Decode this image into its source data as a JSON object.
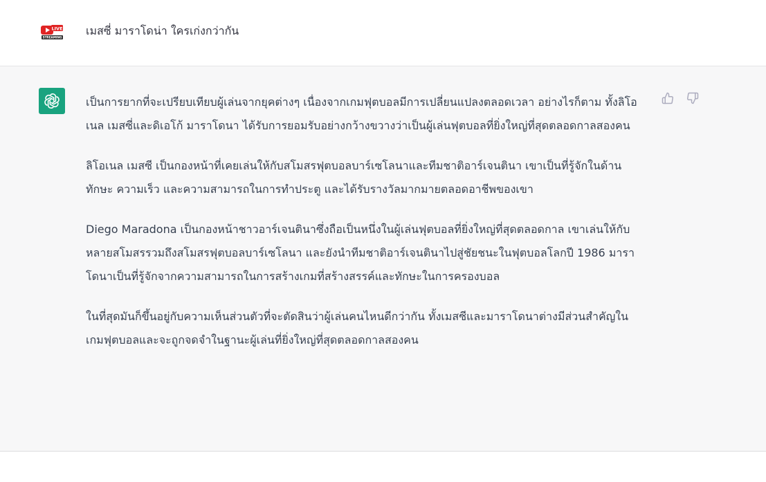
{
  "conversation": {
    "user_message": {
      "avatar_icon": "live-streaming-avatar-icon",
      "avatar_badge": "LIVE",
      "avatar_caption": "STREAMING",
      "text": "เมสซี่ มาราโดน่า ใครเก่งกว่ากัน"
    },
    "assistant_message": {
      "avatar_icon": "openai-logo-icon",
      "avatar_color": "#19a37f",
      "paragraphs": [
        "เป็นการยากที่จะเปรียบเทียบผู้เล่นจากยุคต่างๆ เนื่องจากเกมฟุตบอลมีการเปลี่ยนแปลงตลอดเวลา อย่างไรก็ตาม ทั้งลิโอเนล เมสซี่และดิเอโก้ มาราโดนา ได้รับการยอมรับอย่างกว้างขวางว่าเป็นผู้เล่นฟุตบอลที่ยิ่งใหญ่ที่สุดตลอดกาลสองคน",
        "ลิโอเนล เมสซี เป็นกองหน้าที่เคยเล่นให้กับสโมสรฟุตบอลบาร์เซโลนาและทีมชาติอาร์เจนตินา เขาเป็นที่รู้จักในด้านทักษะ ความเร็ว และความสามารถในการทำประตู และได้รับรางวัลมากมายตลอดอาชีพของเขา",
        "Diego Maradona เป็นกองหน้าชาวอาร์เจนตินาซึ่งถือเป็นหนึ่งในผู้เล่นฟุตบอลที่ยิ่งใหญ่ที่สุดตลอดกาล เขาเล่นให้กับหลายสโมสรรวมถึงสโมสรฟุตบอลบาร์เซโลนา และยังนำทีมชาติอาร์เจนตินาไปสู่ชัยชนะในฟุตบอลโลกปี 1986 มาราโดนาเป็นที่รู้จักจากความสามารถในการสร้างเกมที่สร้างสรรค์และทักษะในการครองบอล",
        "ในที่สุดมันก็ขึ้นอยู่กับความเห็นส่วนตัวที่จะตัดสินว่าผู้เล่นคนไหนดีกว่ากัน ทั้งเมสซีและมาราโดนาต่างมีส่วนสำคัญในเกมฟุตบอลและจะถูกจดจำในฐานะผู้เล่นที่ยิ่งใหญ่ที่สุดตลอดกาลสองคน"
      ],
      "feedback": {
        "like_icon": "thumbs-up-icon",
        "dislike_icon": "thumbs-down-icon"
      }
    }
  }
}
